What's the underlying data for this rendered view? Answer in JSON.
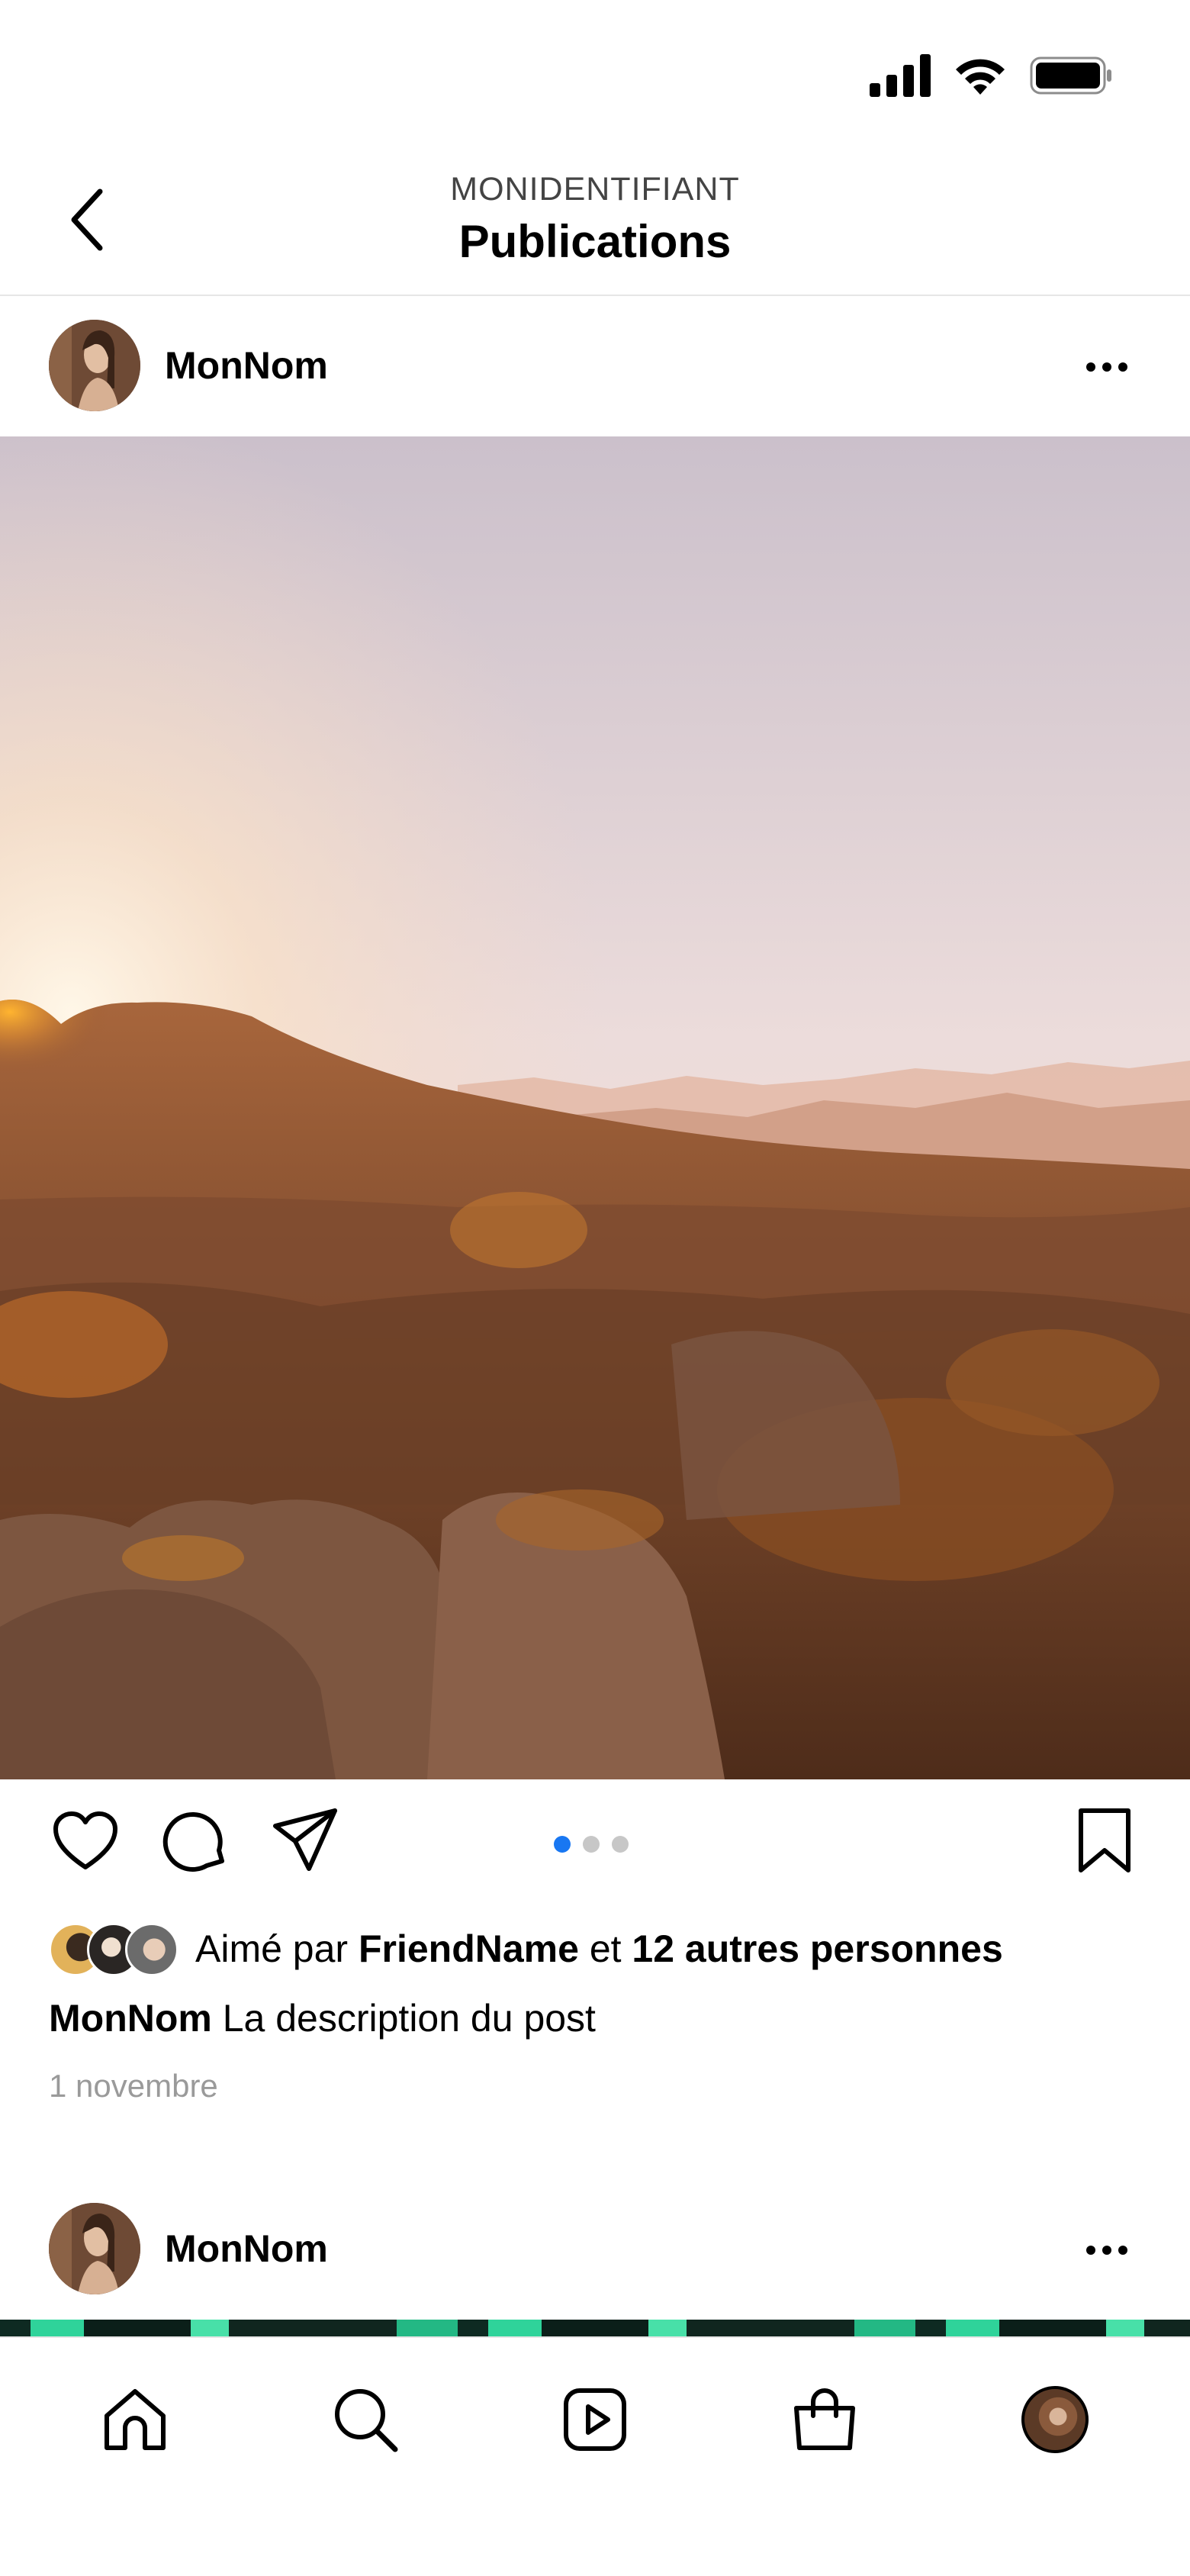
{
  "header": {
    "subtitle": "MONIDENTIFIANT",
    "title": "Publications"
  },
  "posts": [
    {
      "username": "MonNom",
      "carousel": {
        "count": 3,
        "active_index": 0
      },
      "likes": {
        "prefix": "Aimé par ",
        "friend": "FriendName",
        "connector": " et ",
        "others": "12 autres personnes"
      },
      "caption": {
        "username": "MonNom",
        "text": " La description du post"
      },
      "date": "1 novembre"
    },
    {
      "username": "MonNom"
    }
  ],
  "colors": {
    "carousel_active": "#1877f2",
    "carousel_inactive": "#c7c7c7",
    "date_text": "#9a9a9a"
  },
  "icons": {
    "status": [
      "signal-icon",
      "wifi-icon",
      "battery-icon"
    ],
    "header": [
      "back-chevron-icon"
    ],
    "post": [
      "more-icon",
      "heart-icon",
      "comment-icon",
      "share-icon",
      "bookmark-icon"
    ],
    "tabs": [
      "home-icon",
      "search-icon",
      "reels-icon",
      "shop-icon",
      "profile-avatar"
    ]
  }
}
